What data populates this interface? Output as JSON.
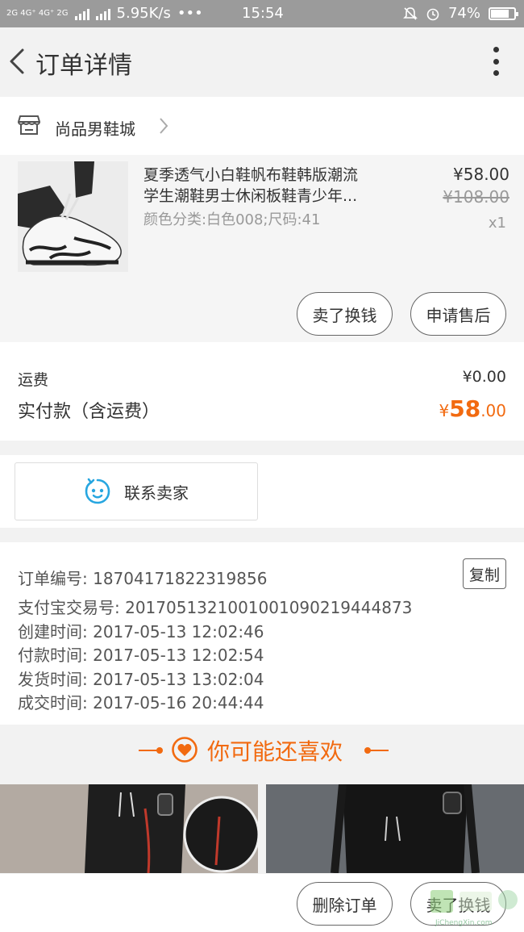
{
  "status_bar": {
    "network": "2G 4G⁺ 4G⁺ 2G",
    "speed": "5.95K/s",
    "dots": "•••",
    "time": "15:54",
    "battery": "74%"
  },
  "header": {
    "title": "订单详情"
  },
  "shop": {
    "name": "尚品男鞋城"
  },
  "item": {
    "title_line1": "夏季透气小白鞋帆布鞋韩版潮流",
    "title_line2": "学生潮鞋男士休闲板鞋青少年...",
    "sku": "颜色分类:白色008;尺码:41",
    "price": "¥58.00",
    "original_price": "¥108.00",
    "quantity": "x1",
    "sell_button": "卖了换钱",
    "after_sale_button": "申请售后"
  },
  "payment": {
    "shipping_label": "运费",
    "shipping_value": "¥0.00",
    "paid_label": "实付款（含运费）",
    "paid_currency": "¥",
    "paid_int": "58",
    "paid_dec": ".00"
  },
  "contact": {
    "label": "联系卖家"
  },
  "order_info": {
    "copy_button": "复制",
    "rows": [
      "订单编号: 18704171822319856",
      "支付宝交易号: 2017051321001001090219444873",
      "创建时间: 2017-05-13 12:02:46",
      "付款时间: 2017-05-13 12:02:54",
      "发货时间: 2017-05-13 13:02:04",
      "成交时间: 2017-05-16 20:44:44"
    ]
  },
  "recommend": {
    "title": "你可能还喜欢"
  },
  "bottom_bar": {
    "delete_button": "删除订单",
    "sell_button": "卖了换钱"
  },
  "watermark": {
    "text": "JiChengXin.com"
  },
  "colors": {
    "accent": "#f26a10",
    "page_bg": "#f2f2f2",
    "status_bar": "#9b9b9b",
    "contact_icon": "#27a6e0"
  },
  "icons": [
    "back-arrow-icon",
    "more-vertical-icon",
    "shop-icon",
    "chevron-right-icon",
    "chat-bubble-icon",
    "heart-icon",
    "watermark-logo"
  ]
}
